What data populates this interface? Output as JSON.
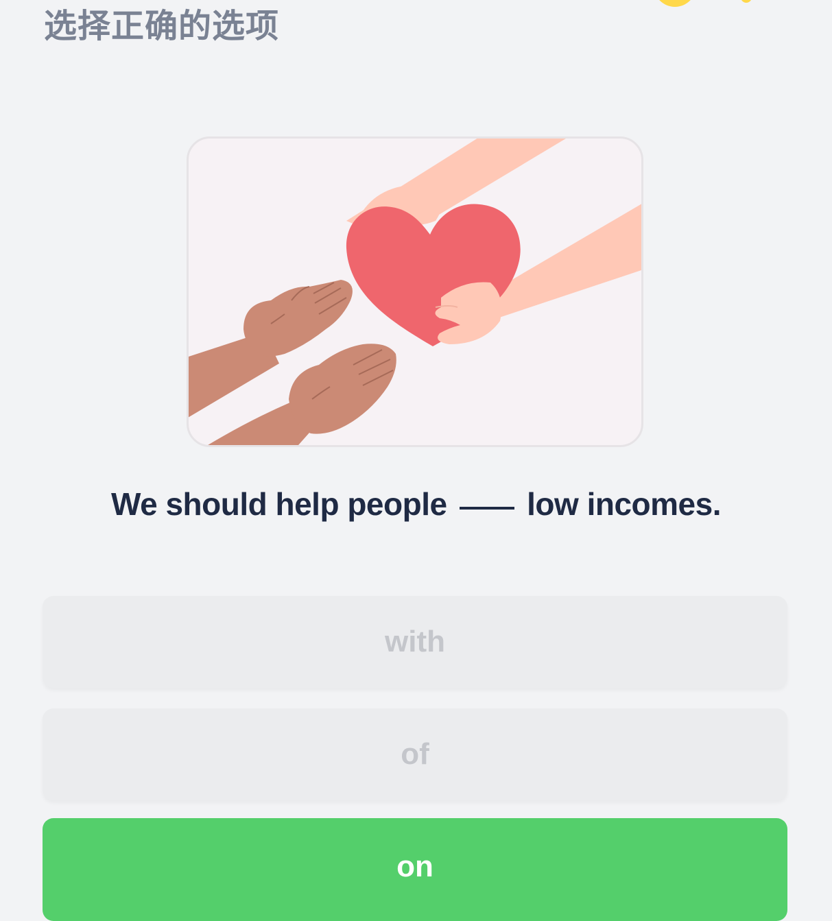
{
  "header": {
    "instruction": "选择正确的选项"
  },
  "illustration": {
    "icon": "giving-heart-hands-illustration",
    "background_color": "#f7f2f5",
    "heart_color": "#ef666d",
    "giver_skin_color": "#ffc8b6",
    "receiver_skin_color": "#cb8a75"
  },
  "question": {
    "before": "We should help people",
    "after": "low incomes."
  },
  "options": [
    {
      "label": "with",
      "state": "disabled"
    },
    {
      "label": "of",
      "state": "disabled"
    },
    {
      "label": "on",
      "state": "selected"
    }
  ],
  "colors": {
    "background": "#f2f3f5",
    "instruction_text": "#7a8293",
    "sentence_text": "#1f2a44",
    "option_bg": "#ebecee",
    "option_text_disabled": "#c4c6cb",
    "selected_bg": "#54cf6b",
    "coin": "#ffd84a"
  }
}
